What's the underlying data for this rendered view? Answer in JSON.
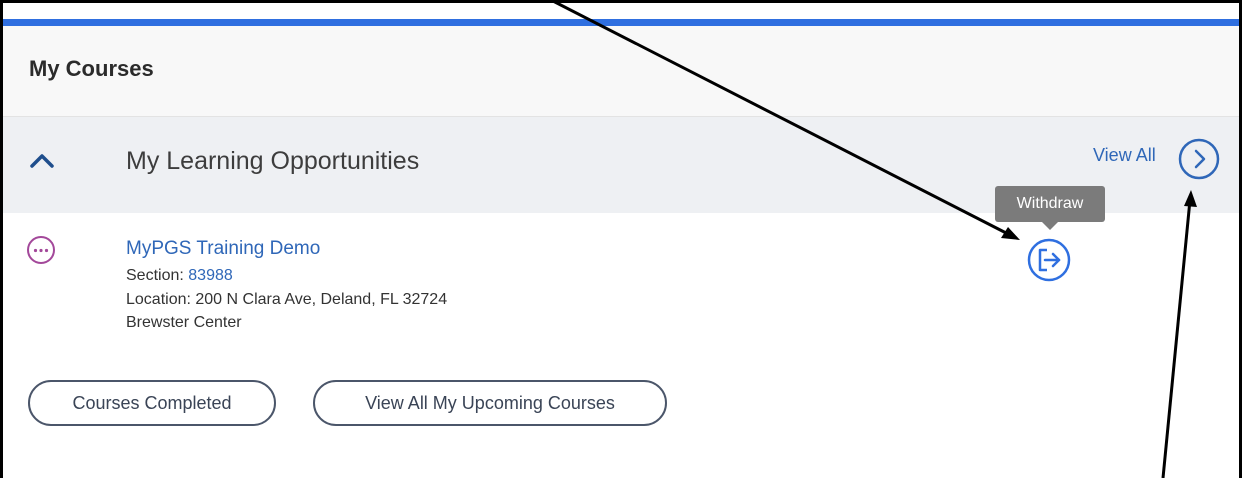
{
  "card": {
    "title": "My Courses"
  },
  "section": {
    "title": "My Learning Opportunities",
    "view_all_label": "View All",
    "icons": {
      "collapse": "chevron-up-icon",
      "view_all": "chevron-right-circle-icon"
    }
  },
  "course": {
    "title": "MyPGS Training Demo",
    "section_label": "Section: ",
    "section_number": "83988",
    "location": "Location: 200 N Clara Ave, Deland, FL 32724",
    "venue": "Brewster Center",
    "icons": {
      "more": "more-options-icon",
      "withdraw": "withdraw-icon"
    }
  },
  "tooltip": {
    "text": "Withdraw"
  },
  "buttons": {
    "courses_completed": "Courses Completed",
    "view_upcoming": "View All My Upcoming Courses"
  },
  "colors": {
    "accent": "#2f6fe0",
    "link": "#2f67b8",
    "more_icon": "#a3489a",
    "tooltip": "#7b7b7b"
  }
}
